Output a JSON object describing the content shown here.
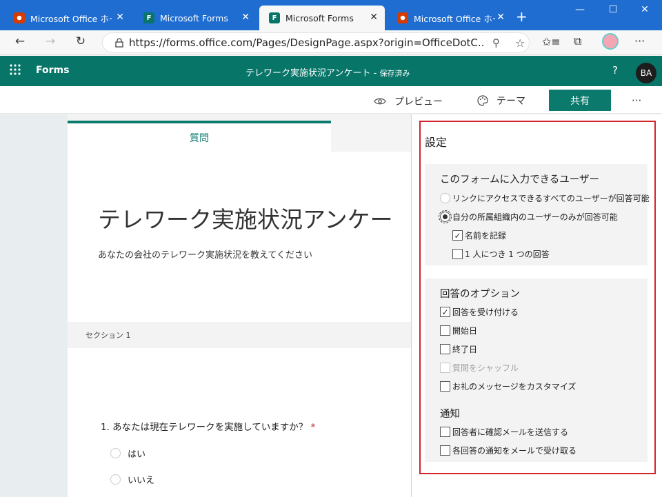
{
  "browser": {
    "tabs": [
      {
        "title": "Microsoft Office ホーム",
        "icon": "office-icon"
      },
      {
        "title": "Microsoft Forms",
        "icon": "forms-icon"
      },
      {
        "title": "Microsoft Forms",
        "icon": "forms-icon",
        "active": true
      },
      {
        "title": "Microsoft Office ホーム",
        "icon": "office-icon"
      }
    ],
    "new_tab": "+",
    "close_glyph": "✕",
    "url": "https://forms.office.com/Pages/DesignPage.aspx?origin=OfficeDotC..."
  },
  "appbar": {
    "app_name": "Forms",
    "form_title": "テレワーク実施状況アンケート",
    "save_status": "保存済み",
    "help": "?",
    "avatar": "BA"
  },
  "commands": {
    "preview": "プレビュー",
    "theme": "テーマ",
    "share": "共有",
    "more": "···"
  },
  "editor": {
    "tab_questions": "質問",
    "form_title": "テレワーク実施状況アンケー",
    "form_description": "あなたの会社のテレワーク実施状況を教えてください",
    "section_label": "セクション 1",
    "question": "1. あなたは現在テレワークを実施していますか？",
    "required_mark": "*",
    "options": [
      "はい",
      "いいえ"
    ]
  },
  "settings": {
    "title": "設定",
    "who_can_fill": {
      "heading": "このフォームに入力できるユーザー",
      "option_anyone": "リンクにアクセスできるすべてのユーザーが回答可能",
      "option_org": "自分の所属組織内のユーザーのみが回答可能",
      "record_name": "名前を記録",
      "one_response": "1 人につき 1 つの回答"
    },
    "response_options": {
      "heading": "回答のオプション",
      "accept_responses": "回答を受け付ける",
      "start_date": "開始日",
      "end_date": "終了日",
      "shuffle": "質問をシャッフル",
      "custom_thanks": "お礼のメッセージをカスタマイズ"
    },
    "notifications": {
      "heading": "通知",
      "send_receipt": "回答者に確認メールを送信する",
      "email_notify": "各回答の通知をメールで受け取る"
    }
  },
  "colors": {
    "brand_teal": "#077568",
    "highlight_red": "#d3222a",
    "tab_blue": "#1f6dd1"
  }
}
